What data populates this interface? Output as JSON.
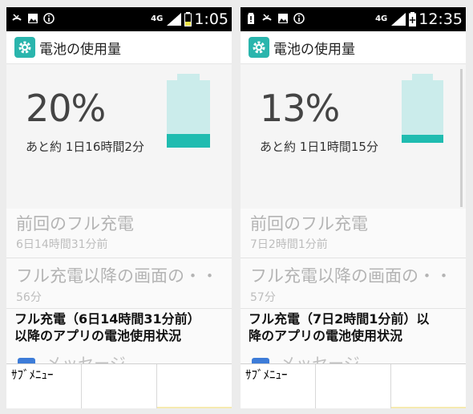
{
  "screens": [
    {
      "status": {
        "network": "4G",
        "time": "1:05",
        "left_icons": [
          "missed-call-icon",
          "image-icon",
          "info-icon"
        ]
      },
      "app_bar": {
        "title": "電池の使用量",
        "icon": "gear-icon"
      },
      "battery": {
        "percent_text": "20%",
        "level": 0.2,
        "remaining": "あと約 1日16時間2分"
      },
      "prefs": [
        {
          "title": "前回のフル充電",
          "summary": "6日14時間31分前"
        },
        {
          "title": "フル充電以降の画面の・・",
          "summary": "56分"
        }
      ],
      "usage_header": {
        "line1": "フル充電（6日14時間31分前）",
        "line2": "以降のアプリの電池使用状況"
      },
      "cut_item": "メッセージ",
      "softkeys": {
        "left": "ｻﾌﾞﾒﾆｭｰ",
        "center": "",
        "right": ""
      }
    },
    {
      "status": {
        "network": "4G",
        "time": "12:35",
        "left_icons": [
          "battery-alert-icon",
          "missed-call-icon",
          "image-icon",
          "info-icon"
        ]
      },
      "app_bar": {
        "title": "電池の使用量",
        "icon": "gear-icon"
      },
      "battery": {
        "percent_text": "13%",
        "level": 0.13,
        "remaining": "あと約 1日1時間15分"
      },
      "prefs": [
        {
          "title": "前回のフル充電",
          "summary": "7日2時間1分前"
        },
        {
          "title": "フル充電以降の画面の・・",
          "summary": "57分"
        }
      ],
      "usage_header": {
        "line1": "フル充電（7日2時間1分前）以",
        "line2": "降のアプリの電池使用状況"
      },
      "cut_item": "メッセージ",
      "softkeys": {
        "left": "ｻﾌﾞﾒﾆｭｰ",
        "center": "",
        "right": ""
      }
    }
  ],
  "colors": {
    "accent": "#2ab5ad",
    "battery_empty": "#cbeceb",
    "battery_fill": "#1fbcb0",
    "softkey_indicator": "#f6eab0"
  }
}
